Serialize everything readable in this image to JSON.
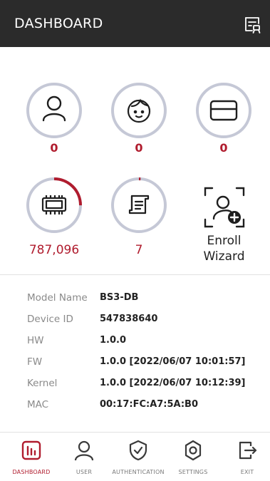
{
  "header": {
    "title": "DASHBOARD",
    "menu_icon": "document-list-icon"
  },
  "colors": {
    "accent": "#b01c2e",
    "ring": "#c5c8d6",
    "header_bg": "#2b2b2b"
  },
  "stats": [
    {
      "icon": "user-icon",
      "count": "0"
    },
    {
      "icon": "face-icon",
      "count": "0"
    },
    {
      "icon": "card-icon",
      "count": "0"
    },
    {
      "icon": "chip-icon",
      "count": "787,096",
      "fill": 0.25
    },
    {
      "icon": "log-icon",
      "count": "7",
      "fill": 0.01
    }
  ],
  "enroll": {
    "label_line1": "Enroll",
    "label_line2": "Wizard",
    "icon": "enroll-user-icon"
  },
  "device_info": [
    {
      "key": "Model Name",
      "value": "BS3-DB"
    },
    {
      "key": "Device ID",
      "value": "547838640"
    },
    {
      "key": "HW",
      "value": "1.0.0"
    },
    {
      "key": "FW",
      "value": "1.0.0 [2022/06/07 10:01:57]"
    },
    {
      "key": "Kernel",
      "value": "1.0.0 [2022/06/07 10:12:39]"
    },
    {
      "key": "MAC",
      "value": "00:17:FC:A7:5A:B0"
    }
  ],
  "nav": [
    {
      "label": "DASHBOARD",
      "icon": "dashboard-icon",
      "active": true
    },
    {
      "label": "USER",
      "icon": "user-icon",
      "active": false
    },
    {
      "label": "AUTHENTICATION",
      "icon": "shield-check-icon",
      "active": false
    },
    {
      "label": "SETTINGS",
      "icon": "gear-icon",
      "active": false
    },
    {
      "label": "EXIT",
      "icon": "exit-icon",
      "active": false
    }
  ]
}
